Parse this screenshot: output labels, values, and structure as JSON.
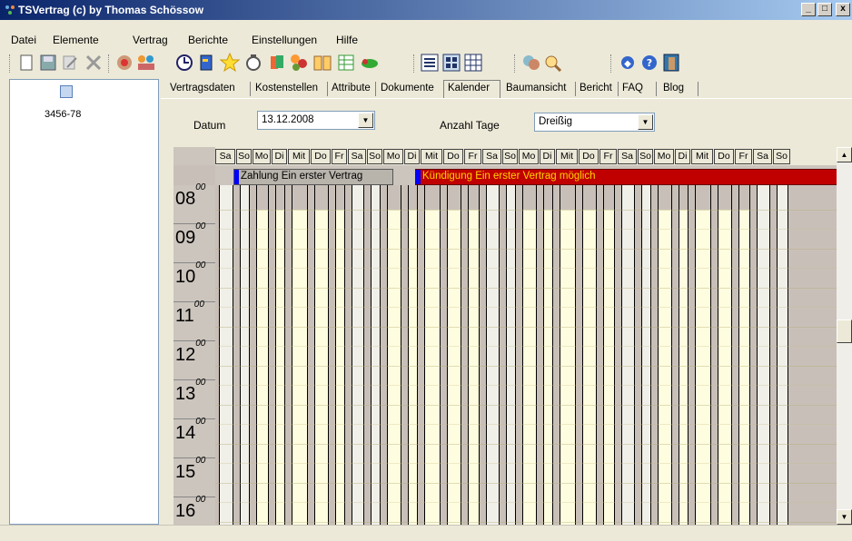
{
  "window": {
    "title": "TSVertrag (c) by Thomas Schössow",
    "minimize": "_",
    "maximize": "□",
    "close": "x"
  },
  "menu": [
    "Datei",
    "Elemente",
    "Vertrag",
    "Berichte",
    "Einstellungen",
    "Hilfe"
  ],
  "toolbar_icons": [
    "new-icon",
    "save-icon",
    "edit-icon",
    "delete-icon",
    "speaker-icon",
    "users-icon",
    "clock-icon",
    "book-icon",
    "star-icon",
    "timer-icon",
    "docs-icon",
    "group-icon",
    "open-book-icon",
    "spreadsheet-icon",
    "tools-icon",
    "view-list-icon",
    "view-details-icon",
    "view-grid-icon",
    "people-icon",
    "search-icon",
    "info-icon",
    "help-icon",
    "exit-icon"
  ],
  "tree": {
    "items": [
      {
        "label": "3456-78"
      }
    ]
  },
  "tabs": [
    "Vertragsdaten",
    "Kostenstellen",
    "Attribute",
    "Dokumente",
    "Kalender",
    "Baumansicht",
    "Bericht",
    "FAQ",
    "Blog"
  ],
  "active_tab": "Kalender",
  "form": {
    "datum_label": "Datum",
    "datum_value": "13.12.2008",
    "tage_label": "Anzahl Tage",
    "tage_value": "Dreißig"
  },
  "calendar": {
    "days": [
      "Sa",
      "So",
      "Mo",
      "Di",
      "Mit",
      "Do",
      "Fr",
      "Sa",
      "So",
      "Mo",
      "Di",
      "Mit",
      "Do",
      "Fr",
      "Sa",
      "So",
      "Mo",
      "Di",
      "Mit",
      "Do",
      "Fr",
      "Sa",
      "So",
      "Mo",
      "Di",
      "Mit",
      "Do",
      "Fr",
      "Sa",
      "So"
    ],
    "events": [
      {
        "label": "Zahlung Ein erster Vertrag",
        "color": "#b8b4ac",
        "marker": "#0000ff"
      },
      {
        "label": "Kündigung Ein erster Vertrag möglich",
        "color": "#c00000",
        "marker": "#0000ff"
      }
    ],
    "hours": [
      "08",
      "09",
      "10",
      "11",
      "12",
      "13",
      "14",
      "15",
      "16"
    ],
    "hour_suffix": "00",
    "weekend_color": "#f0efe8",
    "weekday_color": "#fffde0"
  }
}
